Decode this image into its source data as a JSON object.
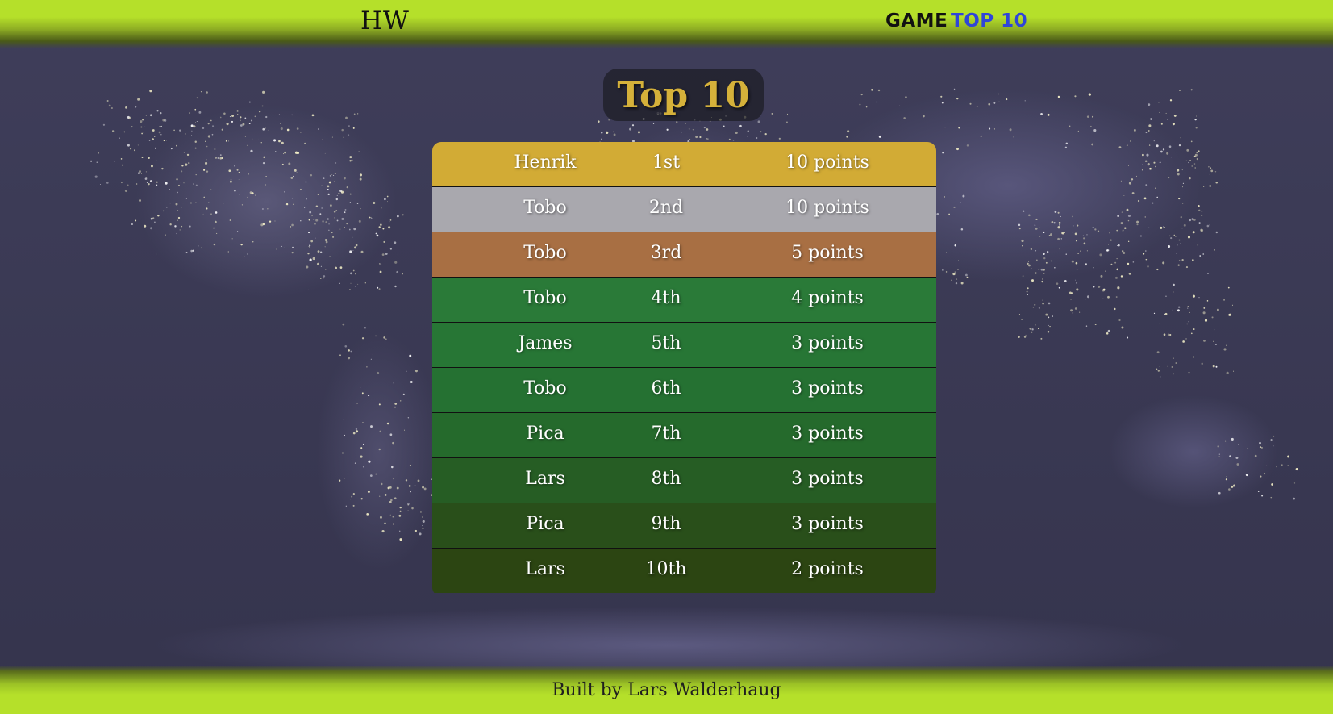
{
  "header": {
    "logo": "HW",
    "nav": [
      {
        "label": "GAME",
        "active": false
      },
      {
        "label": "TOP 10",
        "active": true
      }
    ]
  },
  "main": {
    "title": "Top 10",
    "rows": [
      {
        "name": "Henrik",
        "rank": "1st",
        "points": "10 points",
        "color": "#d2ab35"
      },
      {
        "name": "Tobo",
        "rank": "2nd",
        "points": "10 points",
        "color": "#a9a8ae"
      },
      {
        "name": "Tobo",
        "rank": "3rd",
        "points": "5 points",
        "color": "#a86f43"
      },
      {
        "name": "Tobo",
        "rank": "4th",
        "points": "4 points",
        "color": "#2a7a38"
      },
      {
        "name": "James",
        "rank": "5th",
        "points": "3 points",
        "color": "#277635"
      },
      {
        "name": "Tobo",
        "rank": "6th",
        "points": "3 points",
        "color": "#257132"
      },
      {
        "name": "Pica",
        "rank": "7th",
        "points": "3 points",
        "color": "#256a2c"
      },
      {
        "name": "Lars",
        "rank": "8th",
        "points": "3 points",
        "color": "#265d24"
      },
      {
        "name": "Pica",
        "rank": "9th",
        "points": "3 points",
        "color": "#294f1a"
      },
      {
        "name": "Lars",
        "rank": "10th",
        "points": "2 points",
        "color": "#2c4512"
      }
    ]
  },
  "footer": {
    "text": "Built by Lars Walderhaug"
  },
  "colors": {
    "header_accent": "#b5e02a",
    "active_nav": "#2f45d8",
    "title": "#d5b13a"
  }
}
